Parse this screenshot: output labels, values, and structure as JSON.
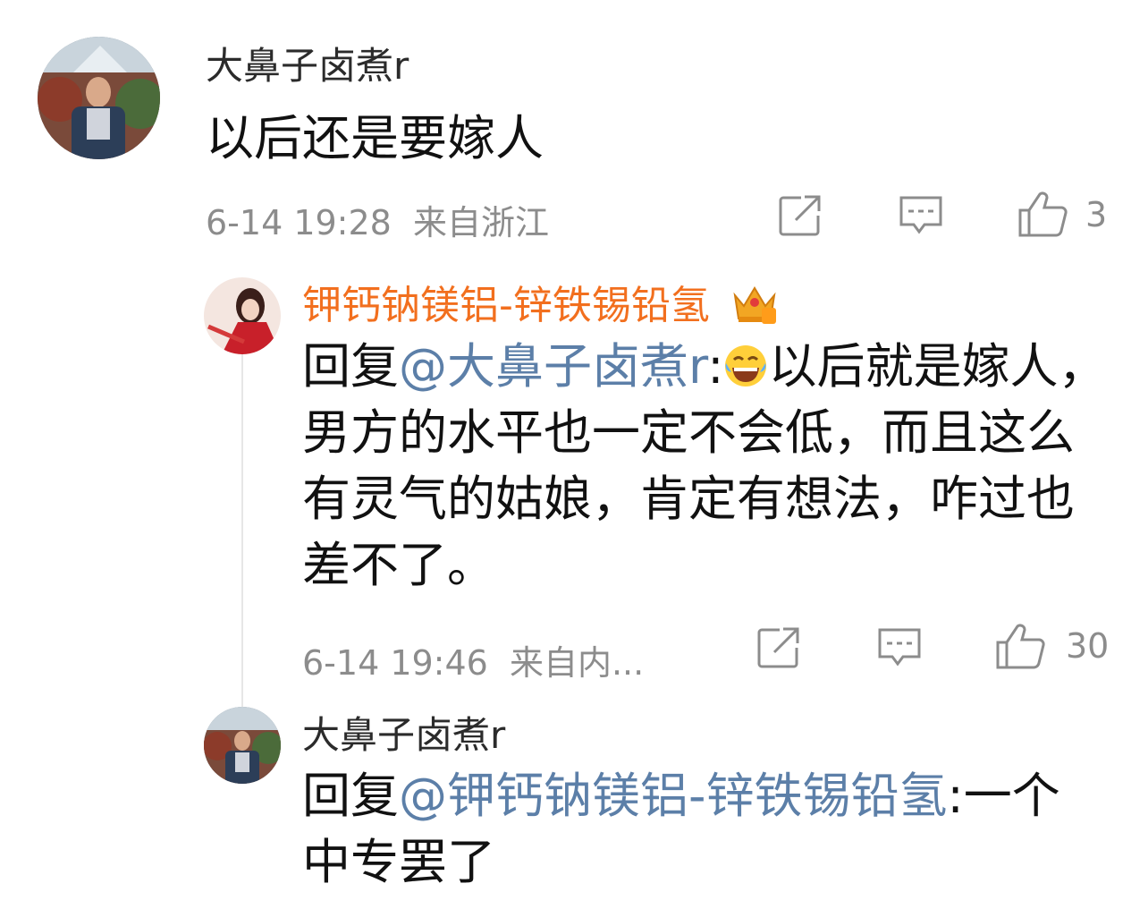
{
  "comment": {
    "username": "大鼻子卤煮r",
    "text": "以后还是要嫁人",
    "time": "6-14 19:28",
    "location": "来自浙江",
    "likes": "3"
  },
  "reply1": {
    "username": "钾钙钠镁铝-锌铁锡铅氢",
    "prefix": "回复",
    "mention": "@大鼻子卤煮r",
    "colon": ":",
    "text": "以后就是嫁人，男方的水平也一定不会低，而且这么有灵气的姑娘，肯定有想法，咋过也差不了。",
    "time": "6-14 19:46",
    "location": "来自内...",
    "likes": "30"
  },
  "reply2": {
    "username": "大鼻子卤煮r",
    "prefix": "回复",
    "mention": "@钾钙钠镁铝-锌铁锡铅氢",
    "colon": ":",
    "text": "一个中专罢了"
  },
  "icons": {
    "share": "share-icon",
    "comment": "comment-icon",
    "like": "thumbs-up-icon",
    "vip": "crown-icon",
    "emoji": "laugh-tears-emoji"
  },
  "colors": {
    "orange_name": "#f26f1e",
    "mention_blue": "#5c7fa8",
    "meta_gray": "#8c8c8c"
  }
}
